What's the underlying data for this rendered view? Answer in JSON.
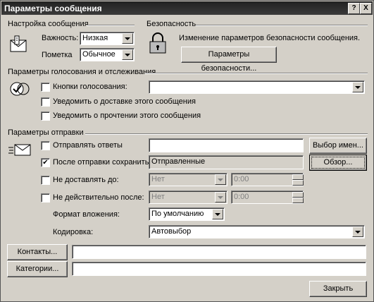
{
  "window": {
    "title": "Параметры сообщения",
    "help_label": "?",
    "close_label": "X"
  },
  "settings": {
    "title": "Настройка сообщения",
    "importance_label": "Важность:",
    "importance_value": "Низкая",
    "sensitivity_label": "Пометка",
    "sensitivity_value": "Обычное"
  },
  "security": {
    "title": "Безопасность",
    "description": "Изменение параметров безопасности сообщения.",
    "button_label": "Параметры безопасности..."
  },
  "voting": {
    "title": "Параметры голосования и отслеживания",
    "voting_buttons_label": "Кнопки голосования:",
    "voting_buttons_value": "",
    "delivery_receipt_label": "Уведомить о доставке этого сообщения",
    "read_receipt_label": "Уведомить о прочтении этого сообщения"
  },
  "delivery": {
    "title": "Параметры отправки",
    "replies_label": "Отправлять ответы",
    "replies_value": "",
    "select_names_label": "Выбор имен...",
    "save_sent_label": "После отправки сохранить в:",
    "save_sent_value": "Отправленные",
    "browse_label": "Обзор...",
    "deliver_after_label": "Не доставлять до:",
    "deliver_after_date": "Нет",
    "deliver_after_time": "0:00",
    "expires_label": "Не действительно после:",
    "expires_date": "Нет",
    "expires_time": "0:00",
    "attachment_format_label": "Формат вложения:",
    "attachment_format_value": "По умолчанию",
    "encoding_label": "Кодировка:",
    "encoding_value": "Автовыбор"
  },
  "contacts": {
    "button_label": "Контакты...",
    "value": ""
  },
  "categories": {
    "button_label": "Категории...",
    "value": ""
  },
  "footer": {
    "close_label": "Закрыть"
  }
}
